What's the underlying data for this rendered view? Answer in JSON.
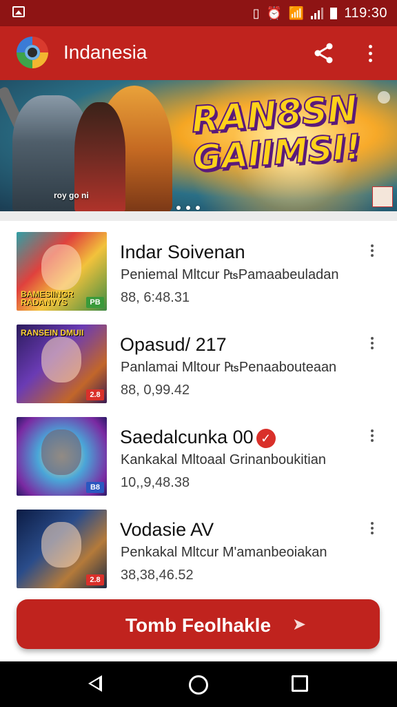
{
  "status": {
    "time": "119:30"
  },
  "app": {
    "title": "Indanesia",
    "share_icon": "share-icon",
    "menu_icon": "more-vert-icon"
  },
  "banner": {
    "title_line1": "RAN8SN",
    "title_line2": "GAIIMSI!",
    "small_text": "roy go ni"
  },
  "items": [
    {
      "title": "Indar Soivenan",
      "desc": "Peniemal Mltcur ₧Pamaabeuladan",
      "num": "88, 6:48.31",
      "thumb_text": "BAMESIINGR RADANVYS",
      "badge": "PB",
      "verified": false
    },
    {
      "title": "Opasud/ 217",
      "desc": "Panlamai Mltour ₧Penaabouteaan",
      "num": "88, 0,99.42",
      "thumb_text": "RANSEIN DMUII",
      "badge": "2.8",
      "verified": false
    },
    {
      "title": "Saedalcunka 00",
      "desc": "Kankakal Mltoaal Grinanboukitian",
      "num": "10,,9,48.38",
      "thumb_text": "",
      "badge": "B8",
      "verified": true
    },
    {
      "title": "Vodasie AV",
      "desc": "Penkakal Mltcur M'amanbeoiakan",
      "num": "38,38,46.52",
      "thumb_text": "",
      "badge": "2.8",
      "verified": false
    }
  ],
  "cta": {
    "label": "Tomb Feolhakle"
  },
  "colors": {
    "primary": "#c0231e",
    "status_bar": "#8e1414"
  }
}
